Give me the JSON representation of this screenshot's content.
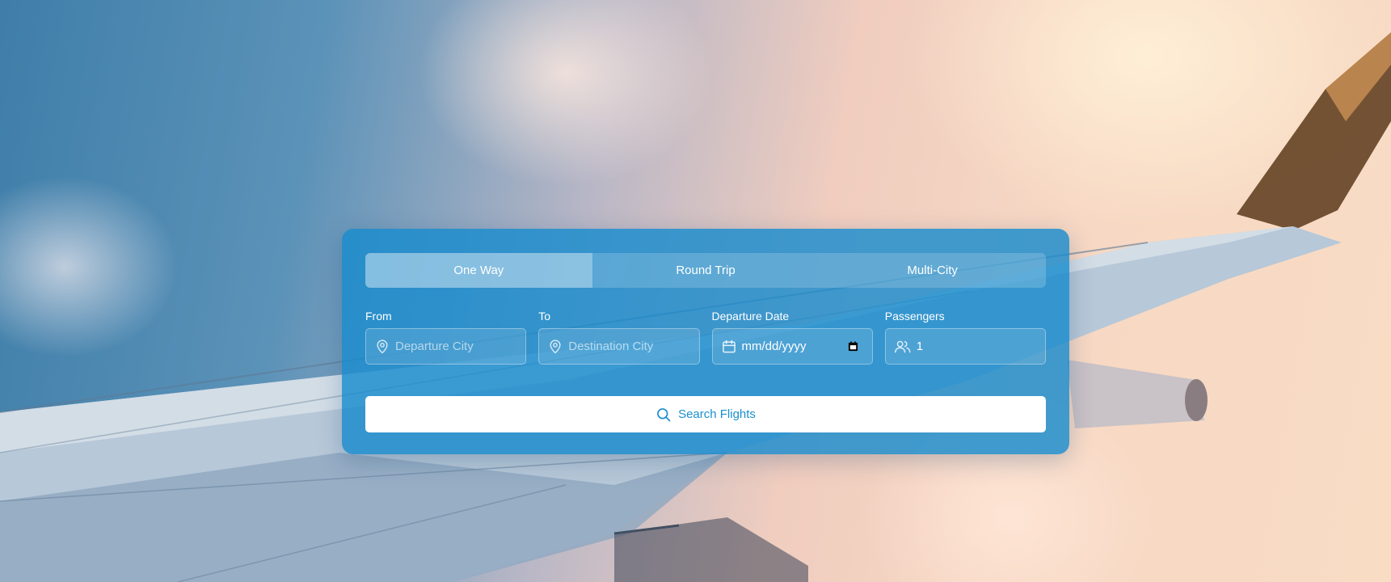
{
  "colors": {
    "card": "#188bcd",
    "accent": "#1a8fcf",
    "text": "#ffffff"
  },
  "tabs": [
    {
      "label": "One Way",
      "active": true
    },
    {
      "label": "Round Trip",
      "active": false
    },
    {
      "label": "Multi-City",
      "active": false
    }
  ],
  "fields": {
    "from": {
      "label": "From",
      "placeholder": "Departure City",
      "value": "",
      "icon": "map-pin-icon"
    },
    "to": {
      "label": "To",
      "placeholder": "Destination City",
      "value": "",
      "icon": "map-pin-icon"
    },
    "date": {
      "label": "Departure Date",
      "value": "mm/dd/yyyy",
      "icon": "calendar-icon"
    },
    "passengers": {
      "label": "Passengers",
      "value": "1",
      "icon": "users-icon"
    }
  },
  "search_button": {
    "label": "Search Flights",
    "icon": "search-icon"
  }
}
